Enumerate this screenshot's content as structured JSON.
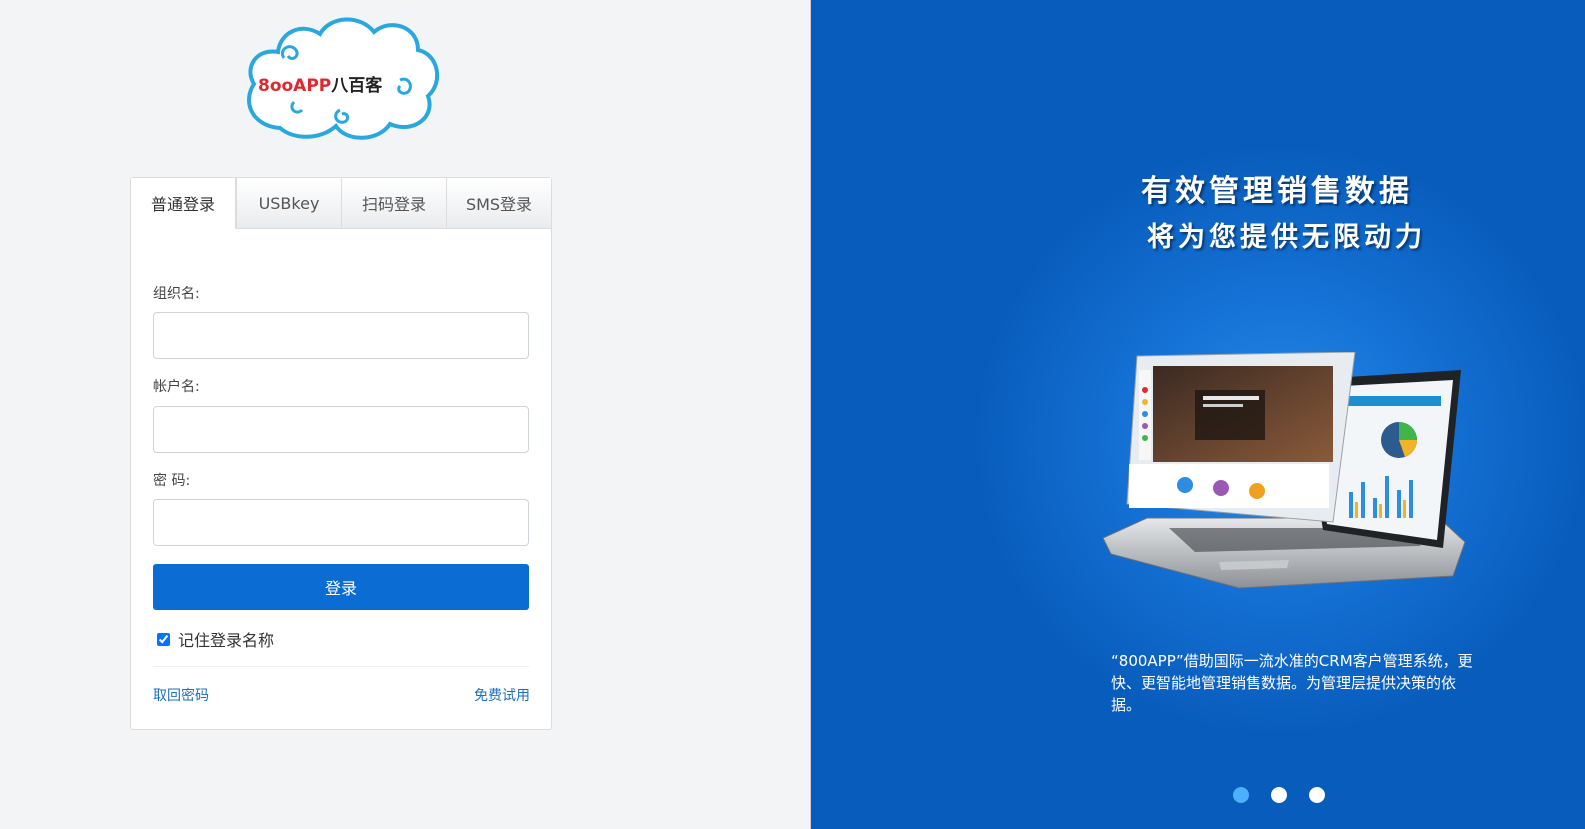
{
  "logo": {
    "text_latin": "8ooAPP",
    "text_cn": "八百客"
  },
  "tabs": [
    {
      "label": "普通登录",
      "active": true
    },
    {
      "label": "USBkey",
      "active": false
    },
    {
      "label": "扫码登录",
      "active": false
    },
    {
      "label": "SMS登录",
      "active": false
    }
  ],
  "form": {
    "org_label": "组织名:",
    "org_value": "",
    "account_label": "帐户名:",
    "account_value": "",
    "password_label": "密 码:",
    "password_value": "",
    "login_label": "登录",
    "remember_label": "记住登录名称",
    "remember_checked": true,
    "forgot_label": "取回密码",
    "trial_label": "免费试用"
  },
  "promo": {
    "headline_1": "有效管理销售数据",
    "headline_2": "将为您提供无限动力",
    "description": "“800APP”借助国际一流水准的CRM客户管理系统，更快、更智能地管理销售数据。为管理层提供决策的依据。",
    "slides": [
      {
        "active": true
      },
      {
        "active": false
      },
      {
        "active": false
      }
    ]
  },
  "colors": {
    "primary_button": "#0b6dd3",
    "link": "#1d6fc0",
    "promo_background": "#085cbb",
    "active_dot": "#4cb0ff"
  }
}
